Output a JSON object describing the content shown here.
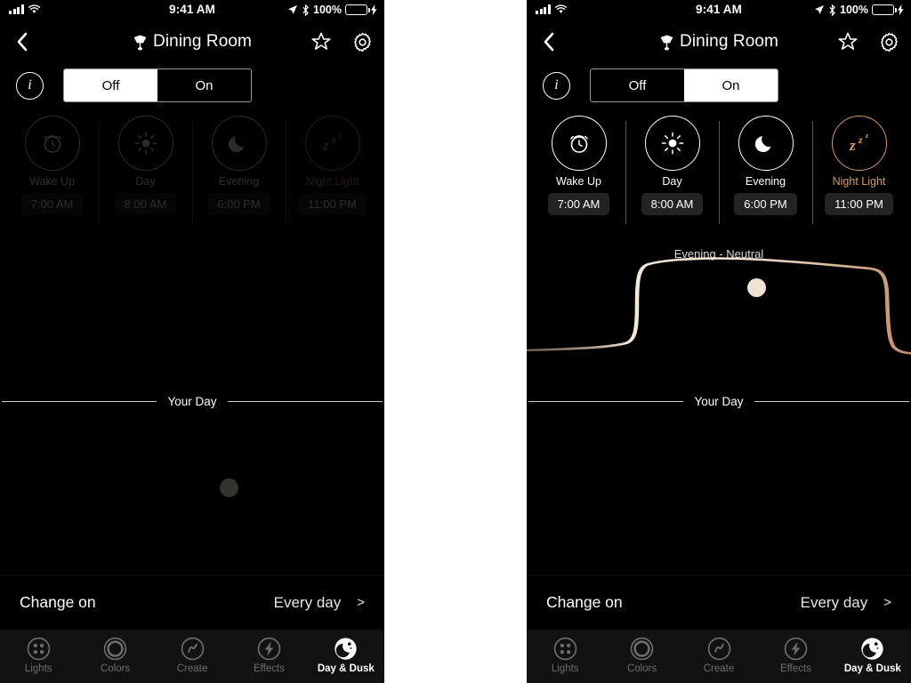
{
  "status_bar": {
    "time": "9:41 AM",
    "battery_percent": "100%",
    "signal_icon": "cellular-bars-icon",
    "wifi_icon": "wifi-icon",
    "location_icon": "location-arrow-icon",
    "bluetooth_icon": "bluetooth-icon",
    "battery_icon": "battery-icon",
    "charging_icon": "lightning-bolt-icon",
    "battery_color": "#4cd964"
  },
  "header": {
    "back_icon": "chevron-left-icon",
    "lamp_icon": "pendant-lamp-icon",
    "title": "Dining Room",
    "favorite_icon": "star-outline-icon",
    "settings_icon": "gear-icon"
  },
  "power_control": {
    "info_icon": "info-icon",
    "info_label": "i",
    "options": [
      "Off",
      "On"
    ],
    "selected_left": "Off",
    "selected_right": "On"
  },
  "schedule": {
    "tiles": [
      {
        "icon": "alarm-clock-icon",
        "label": "Wake Up",
        "time": "7:00 AM",
        "accent": false
      },
      {
        "icon": "sun-icon",
        "label": "Day",
        "time": "8:00 AM",
        "accent": false
      },
      {
        "icon": "moon-icon",
        "label": "Evening",
        "time": "6:00 PM",
        "accent": false
      },
      {
        "icon": "sleep-zzz-icon",
        "label": "Night Light",
        "time": "11:00 PM",
        "accent": true
      }
    ],
    "accent_color": "#d79a61"
  },
  "curve": {
    "caption": "Evening - Neutral",
    "handle_icon": "drag-handle-dot",
    "handle_color": "#efe4d4",
    "gradient_start": "#6b5d52",
    "gradient_mid": "#f2e8d8",
    "gradient_end": "#c08c6a"
  },
  "your_day": {
    "label": "Your Day"
  },
  "change_on": {
    "label": "Change on",
    "value": "Every day",
    "chevron": ">"
  },
  "tabbar": {
    "items": [
      {
        "icon": "lights-dots-icon",
        "label": "Lights",
        "active": false
      },
      {
        "icon": "colors-rings-icon",
        "label": "Colors",
        "active": false
      },
      {
        "icon": "create-squiggle-icon",
        "label": "Create",
        "active": false
      },
      {
        "icon": "effects-bolt-icon",
        "label": "Effects",
        "active": false
      },
      {
        "icon": "day-dusk-moon-icon",
        "label": "Day & Dusk",
        "active": true
      }
    ]
  },
  "chart_data": {
    "type": "line",
    "title": "Evening - Neutral",
    "xlabel": "Your Day",
    "ylabel": "",
    "x": [
      0,
      10,
      28,
      34,
      38,
      50,
      62,
      70,
      82,
      90,
      94,
      97,
      100
    ],
    "values": [
      6,
      7,
      9,
      30,
      76,
      80,
      81,
      80,
      78,
      76,
      72,
      30,
      5
    ],
    "ylim": [
      0,
      100
    ],
    "grid": false,
    "legend": false,
    "annotations": [
      {
        "label": "handle",
        "x": 62,
        "y": 81
      }
    ]
  }
}
